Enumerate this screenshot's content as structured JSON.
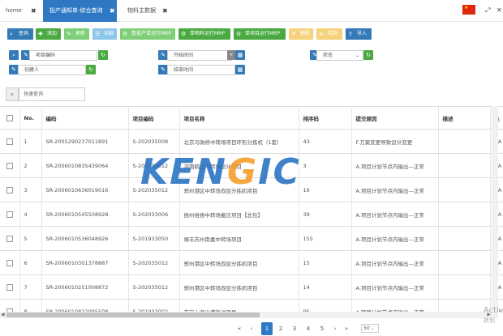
{
  "tabs": [
    {
      "label": "home"
    },
    {
      "label": "投产通知单-综合查询"
    },
    {
      "label": "物料主数据"
    }
  ],
  "toolbar": {
    "query": "查询",
    "add": "添加",
    "edit": "更新",
    "detail": "详细",
    "mrp_sheet": "整投产单运行MRP",
    "mrp_material": "单物料运行MRP",
    "mrp_project": "单项目运行MRP",
    "delete": "删除",
    "cancel": "取消",
    "import": "导入"
  },
  "filters": {
    "project_code": "项目编码",
    "creator": "创建人",
    "start_time": "开始时间",
    "end_time": "结束时间",
    "status": "状态"
  },
  "quick_search": {
    "placeholder": "快速查询"
  },
  "table": {
    "headers": [
      "No.",
      "编码",
      "项目编码",
      "项目名称",
      "排序码",
      "提交原因",
      "描述",
      "主"
    ],
    "rows": [
      {
        "no": "1",
        "code": "SR-2005290237011891",
        "project_code": "S-202035008",
        "project_name": "北京马驹桥中转场项目环形分拣机（1套）",
        "sort": "43",
        "reason": "F.方案变更导致设计变更",
        "desc": "",
        "main": "RA"
      },
      {
        "no": "2",
        "code": "SR-2006010835439064",
        "project_code": "S-202033012",
        "project_name": "河南鹤山中转场设计项目",
        "sort": "3",
        "reason": "A.项目计划节点内输出—正常",
        "desc": "",
        "main": "RA"
      },
      {
        "no": "3",
        "code": "SR-2006010636019016",
        "project_code": "S-202035012",
        "project_name": "郑州港区中转场双层分拣机项目",
        "sort": "16",
        "reason": "A.项目计划节点内输出—正常",
        "desc": "",
        "main": "RA"
      },
      {
        "no": "4",
        "code": "SR-2006010545508928",
        "project_code": "S-202033006",
        "project_name": "扬州维扬中转场搬迁项目【总包】",
        "sort": "39",
        "reason": "A.项目计划节点内输出—正常",
        "desc": "",
        "main": "RA"
      },
      {
        "no": "5",
        "code": "SR-2006010536048926",
        "project_code": "S-201933050",
        "project_name": "顺丰苏州南嘉中转场项目",
        "sort": "155",
        "reason": "A.项目计划节点内输出—正常",
        "desc": "",
        "main": "RA"
      },
      {
        "no": "6",
        "code": "SR-2006010301378887",
        "project_code": "S-202035012",
        "project_name": "郑州港区中转场双层分拣机项目",
        "sort": "15",
        "reason": "A.项目计划节点内输出—正常",
        "desc": "",
        "main": "RA"
      },
      {
        "no": "7",
        "code": "SR-2006010251008872",
        "project_code": "S-202035012",
        "project_name": "郑州港区中转场双层分拣机项目",
        "sort": "14",
        "reason": "A.项目计划节点内输出—正常",
        "desc": "",
        "main": "RA"
      },
      {
        "no": "8",
        "code": "SR-2006010822095508",
        "project_code": "S-201933002",
        "project_name": "苏宁上海出港输送项目",
        "sort": "95",
        "reason": "A.项目计划节点内输出—正常",
        "desc": "",
        "main": "RA"
      }
    ]
  },
  "pagination": {
    "pages": [
      "1",
      "2",
      "3",
      "4",
      "5"
    ],
    "active": "1",
    "page_size": "50"
  },
  "watermark": {
    "prefix": "KEN",
    "o_letter": "G",
    "suffix": "IC"
  },
  "os_watermark": {
    "line1": "Activ",
    "line2": "转到"
  },
  "colors": {
    "primary": "#2f78c4",
    "success": "#4aaa41",
    "logo_blue": "#1f6dc0",
    "logo_orange": "#f39a1e"
  }
}
